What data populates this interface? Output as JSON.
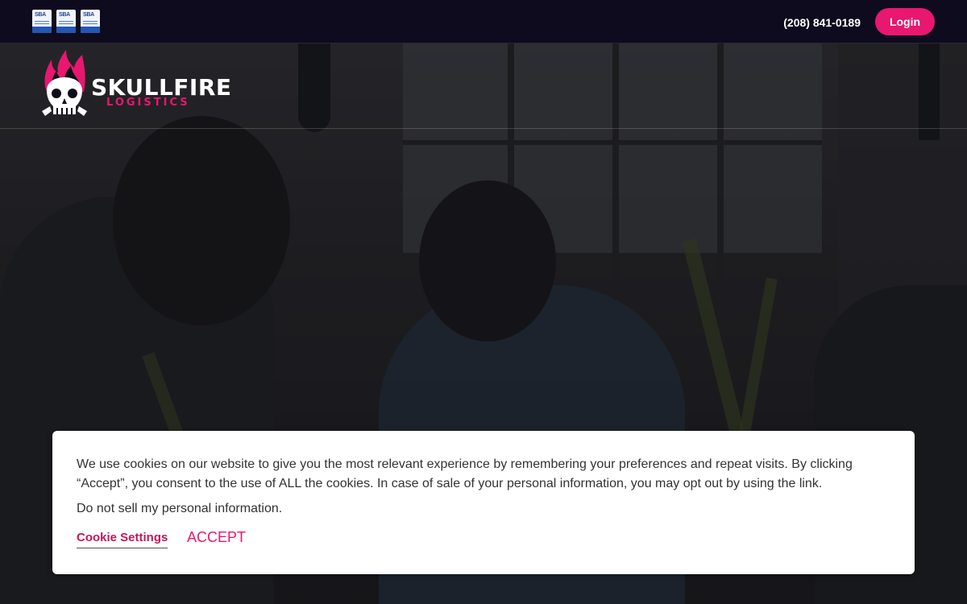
{
  "topbar": {
    "badges": [
      {
        "label": "SBA"
      },
      {
        "label": "SBA"
      },
      {
        "label": "SBA"
      }
    ],
    "phone": "(208) 841-0189",
    "login_label": "Login"
  },
  "logo": {
    "word1": "SKULLFIRE",
    "word2": "LOGISTICS",
    "flame_color": "#e8176f"
  },
  "cookie_banner": {
    "text": "We use cookies on our website to give you the most relevant experience by remembering your preferences and repeat visits. By clicking “Accept”, you consent to the use of ALL the cookies. In case of sale of your personal information, you may opt out by using the link.",
    "do_not_sell": "Do not sell my personal information.",
    "settings_label": "Cookie Settings",
    "accept_label": "ACCEPT"
  },
  "colors": {
    "accent": "#e8176f",
    "topbar_bg": "#0f0b1e"
  }
}
